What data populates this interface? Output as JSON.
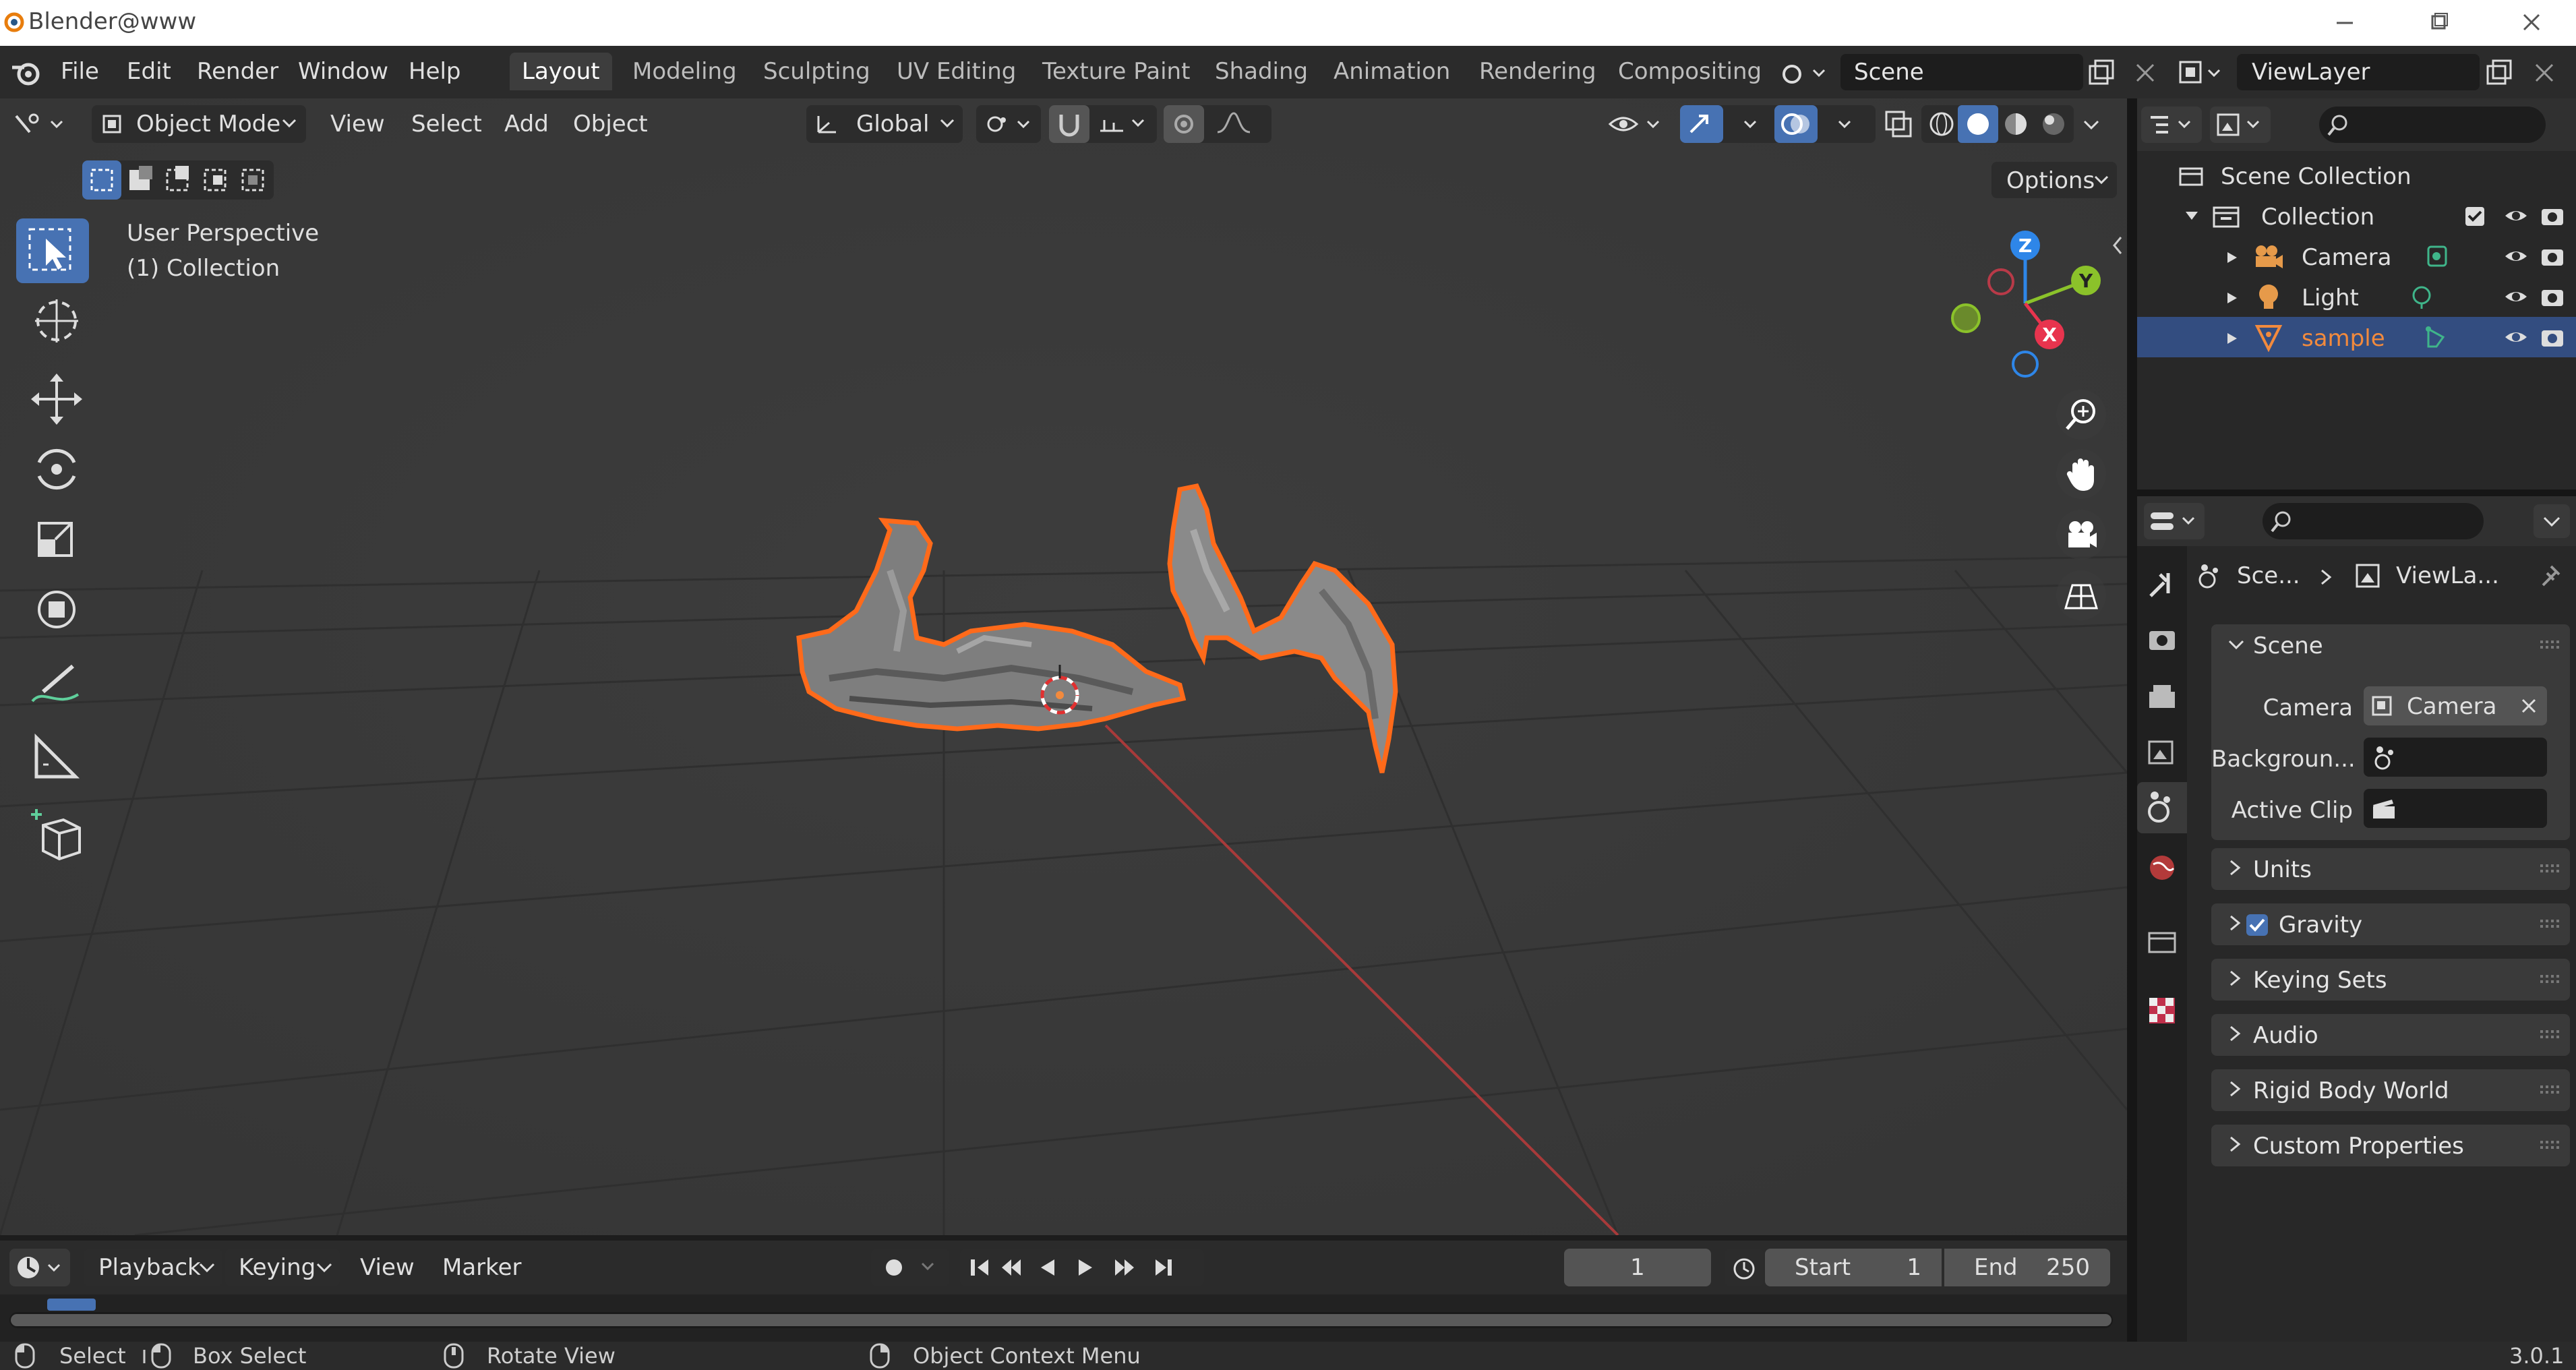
{
  "window": {
    "title": "Blender@www"
  },
  "menu": {
    "file": "File",
    "edit": "Edit",
    "render": "Render",
    "window": "Window",
    "help": "Help"
  },
  "workspaces": [
    "Layout",
    "Modeling",
    "Sculpting",
    "UV Editing",
    "Texture Paint",
    "Shading",
    "Animation",
    "Rendering",
    "Compositing"
  ],
  "scene_field": "Scene",
  "viewlayer_field": "ViewLayer",
  "viewport_header": {
    "mode": "Object Mode",
    "view": "View",
    "select": "Select",
    "add": "Add",
    "object": "Object",
    "orientation": "Global",
    "options": "Options"
  },
  "viewport_overlay": {
    "perspective": "User Perspective",
    "collection": "(1) Collection"
  },
  "gizmo": {
    "x": "X",
    "y": "Y",
    "z": "Z"
  },
  "outliner": {
    "scene_collection": "Scene Collection",
    "collection": "Collection",
    "items": [
      {
        "label": "Camera",
        "color": "#e0e0e0"
      },
      {
        "label": "Light",
        "color": "#e0e0e0"
      },
      {
        "label": "sample",
        "color": "#f28a3d"
      }
    ]
  },
  "properties": {
    "breadcrumb": {
      "scene": "Sce...",
      "viewlayer": "ViewLa..."
    },
    "scene_panel": "Scene",
    "camera_label": "Camera",
    "camera_value": "Camera",
    "background_label": "Backgroun...",
    "active_clip_label": "Active Clip",
    "panels": [
      "Units",
      "Gravity",
      "Keying Sets",
      "Audio",
      "Rigid Body World",
      "Custom Properties"
    ],
    "gravity_checked": true
  },
  "timeline": {
    "playback": "Playback",
    "keying": "Keying",
    "view": "View",
    "marker": "Marker",
    "current_frame": "1",
    "start_label": "Start",
    "start_value": "1",
    "end_label": "End",
    "end_value": "250"
  },
  "statusbar": {
    "select": "Select",
    "box_select": "Box Select",
    "rotate_view": "Rotate View",
    "context_menu": "Object Context Menu",
    "version": "3.0.1"
  },
  "colors": {
    "accent": "#4772b3",
    "selection": "#f28a3d",
    "x_axis": "#e8344e",
    "y_axis": "#8bc22a",
    "z_axis": "#2e86e8"
  }
}
